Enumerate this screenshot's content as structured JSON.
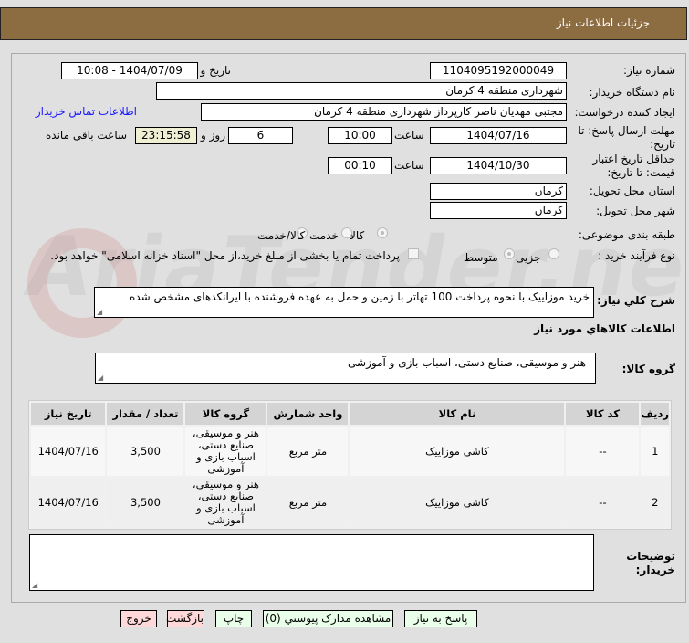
{
  "header": {
    "title": "جزئیات اطلاعات نیاز"
  },
  "watermark": "AriaTender.net",
  "form": {
    "need_number_label": "شماره نیاز:",
    "need_number": "1104095192000049",
    "announce_label": "تاریخ و ساعت اعلان عمومی:",
    "announce_value": "1404/07/09 - 10:08",
    "buyer_org_label": "نام دستگاه خریدار:",
    "buyer_org": "شهرداری منطقه 4 کرمان",
    "creator_label": "ایجاد کننده درخواست:",
    "creator": "مجتبی مهدیان ناصر کارپرداز شهرداری منطقه 4 کرمان",
    "contact_link": "اطلاعات تماس خریدار",
    "deadline_label": "مهلت ارسال پاسخ: تا تاریخ:",
    "deadline_date": "1404/07/16",
    "time_label": "ساعت",
    "deadline_time": "10:00",
    "days": "6",
    "days_label": "روز و",
    "remaining": "23:15:58",
    "remaining_label": "ساعت باقی مانده",
    "validity_label": "حداقل تاریخ اعتبار قیمت: تا تاریخ:",
    "validity_date": "1404/10/30",
    "validity_time": "00:10",
    "province_label": "استان محل تحویل:",
    "province": "کرمان",
    "city_label": "شهر محل تحویل:",
    "city": "کرمان",
    "category_label": "طبقه بندی موضوعی:",
    "category_options": [
      "کالا",
      "خدمت",
      "کالا/خدمت"
    ],
    "category_selected": "کالا",
    "process_label": "نوع فرآیند خرید :",
    "process_options": [
      "جزیی",
      "متوسط"
    ],
    "process_selected": "متوسط",
    "payment_note": "پرداخت تمام یا بخشی از مبلغ خرید،از محل \"اسناد خزانه اسلامی\" خواهد بود.",
    "description_label": "شرح کلي نیاز:",
    "description": "خرید موزاییک با نحوه پرداخت 100 تهاتر با زمین و حمل به عهده فروشنده با ایرانکدهای مشخص شده",
    "goods_info_title": "اطلاعات کالاهاي مورد نیاز",
    "goods_group_label": "گروه کالا:",
    "goods_group": "هنر و موسیقی، صنایع دستی، اسباب بازی و آموزشی",
    "notes_label": "توضیحات خریدار:",
    "notes": ""
  },
  "table": {
    "headers": [
      "ردیف",
      "کد کالا",
      "نام کالا",
      "واحد شمارش",
      "گروه کالا",
      "تعداد / مقدار",
      "تاریخ نیاز"
    ],
    "rows": [
      [
        "1",
        "--",
        "کاشی موزاییک",
        "متر مربع",
        "هنر و موسیقی، صنایع دستی، اسباب بازی و آموزشی",
        "3,500",
        "1404/07/16"
      ],
      [
        "2",
        "--",
        "کاشی موزاییک",
        "متر مربع",
        "هنر و موسیقی، صنایع دستی، اسباب بازی و آموزشی",
        "3,500",
        "1404/07/16"
      ]
    ]
  },
  "buttons": {
    "reply": "پاسخ به نیاز",
    "attachments": "مشاهده مدارک پیوستي (0)",
    "print": "چاپ",
    "back": "بازگشت",
    "exit": "خروج"
  }
}
